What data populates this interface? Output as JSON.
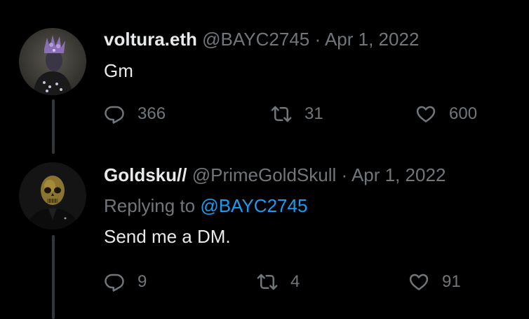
{
  "tweets": [
    {
      "display_name": "voltura.eth",
      "handle": "@BAYC2745",
      "separator": "·",
      "date": "Apr 1, 2022",
      "text": "Gm",
      "replies": "366",
      "retweets": "31",
      "likes": "600",
      "avatar_icon": "voltura-avatar"
    },
    {
      "display_name": "Goldsku//",
      "handle": "@PrimeGoldSkull",
      "separator": "·",
      "date": "Apr 1, 2022",
      "replying_to_label": "Replying to",
      "replying_to_handle": "@BAYC2745",
      "text": "Send me a DM.",
      "replies": "9",
      "retweets": "4",
      "likes": "91",
      "avatar_icon": "gold-skull-avatar"
    }
  ],
  "colors": {
    "background": "#000000",
    "text": "#e7e9ea",
    "muted": "#71767b",
    "link": "#1d9bf0",
    "thread_line": "#333639"
  }
}
